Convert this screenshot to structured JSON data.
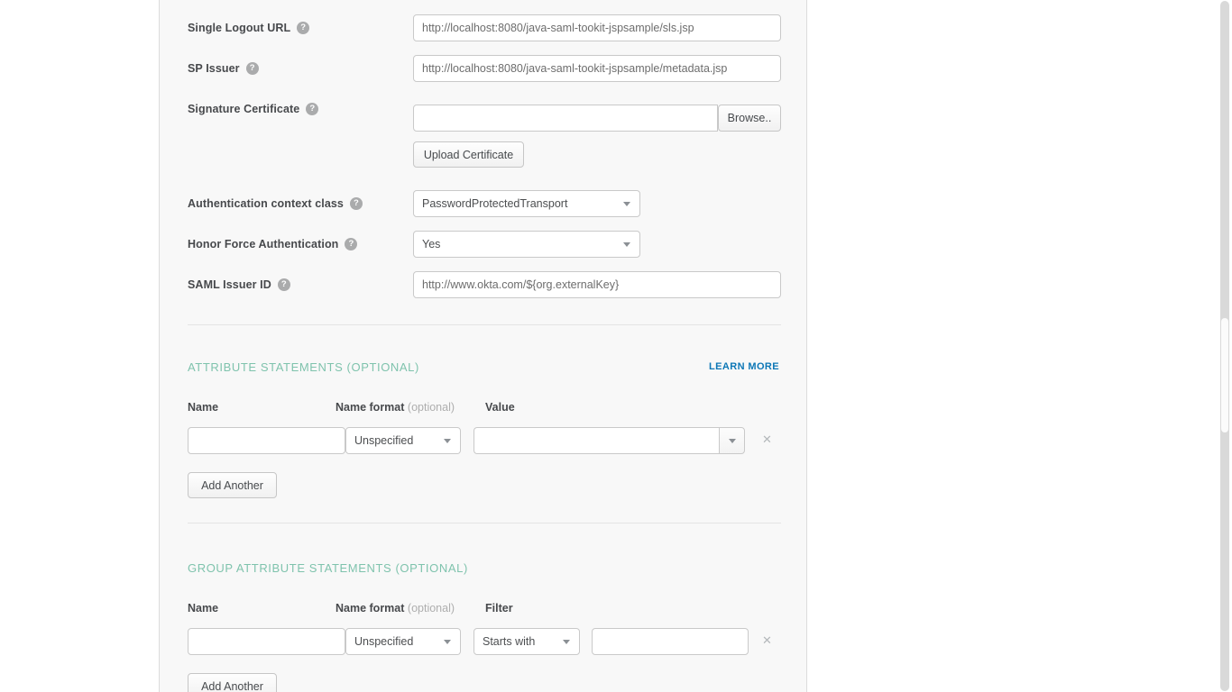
{
  "icons": {
    "help": "?",
    "remove": "✕"
  },
  "colors": {
    "section_heading": "#7fc3ad",
    "link_blue": "#0d77b6",
    "card_bg": "#f8f8f8"
  },
  "fields": {
    "single_logout_url": {
      "label": "Single Logout URL",
      "value": "http://localhost:8080/java-saml-tookit-jspsample/sls.jsp"
    },
    "sp_issuer": {
      "label": "SP Issuer",
      "value": "http://localhost:8080/java-saml-tookit-jspsample/metadata.jsp"
    },
    "signature_certificate": {
      "label": "Signature Certificate",
      "file_value": "",
      "browse_label": "Browse..",
      "upload_label": "Upload Certificate"
    },
    "authentication_context_class": {
      "label": "Authentication context class",
      "value": "PasswordProtectedTransport"
    },
    "honor_force_authentication": {
      "label": "Honor Force Authentication",
      "value": "Yes"
    },
    "saml_issuer_id": {
      "label": "SAML Issuer ID",
      "value": "http://www.okta.com/${org.externalKey}"
    }
  },
  "attribute_statements": {
    "heading": "ATTRIBUTE STATEMENTS (OPTIONAL)",
    "learn_more_label": "LEARN MORE",
    "columns": {
      "name": "Name",
      "name_format": "Name format",
      "name_format_note": "(optional)",
      "value": "Value"
    },
    "row": {
      "name": "",
      "name_format": "Unspecified",
      "value": ""
    },
    "add_button_label": "Add Another"
  },
  "group_attribute_statements": {
    "heading": "GROUP ATTRIBUTE STATEMENTS (OPTIONAL)",
    "columns": {
      "name": "Name",
      "name_format": "Name format",
      "name_format_note": "(optional)",
      "filter": "Filter"
    },
    "row": {
      "name": "",
      "name_format": "Unspecified",
      "filter_type": "Starts with",
      "filter_value": ""
    },
    "add_button_label": "Add Another"
  }
}
